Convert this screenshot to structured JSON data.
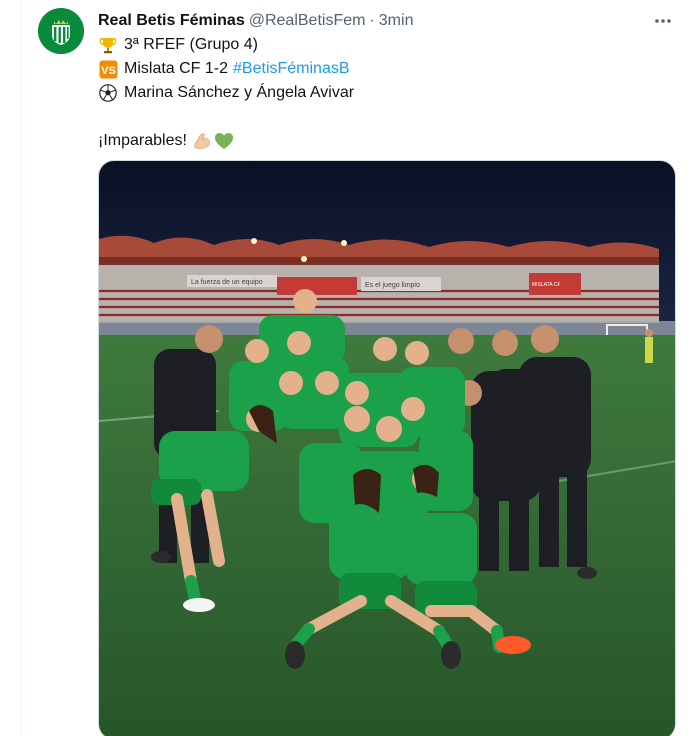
{
  "tweet": {
    "author_name": "Real Betis Féminas",
    "author_handle": "@RealBetisFem",
    "separator": "·",
    "timestamp": "3min",
    "lines": [
      {
        "icon": "trophy-icon",
        "text": "3ª RFEF (Grupo 4)"
      },
      {
        "icon": "vs-icon",
        "text": "Mislata CF 1-2",
        "hashtag": "#BetisFéminasB"
      },
      {
        "icon": "soccer-ball-icon",
        "text": "Marina Sánchez y Ángela Avivar"
      }
    ],
    "closing_text": "¡Imparables!",
    "closing_icons": [
      "flexed-biceps-icon",
      "green-heart-icon"
    ],
    "vs_badge": "VS"
  },
  "photo": {
    "banner_texts": [
      "La fuerza de un equipo",
      "Es el juego limpio",
      "MISLATA CF"
    ]
  },
  "colors": {
    "link": "#1d9bf0",
    "muted": "#536471",
    "text": "#0f1419",
    "brand_green": "#0a8a3c"
  }
}
